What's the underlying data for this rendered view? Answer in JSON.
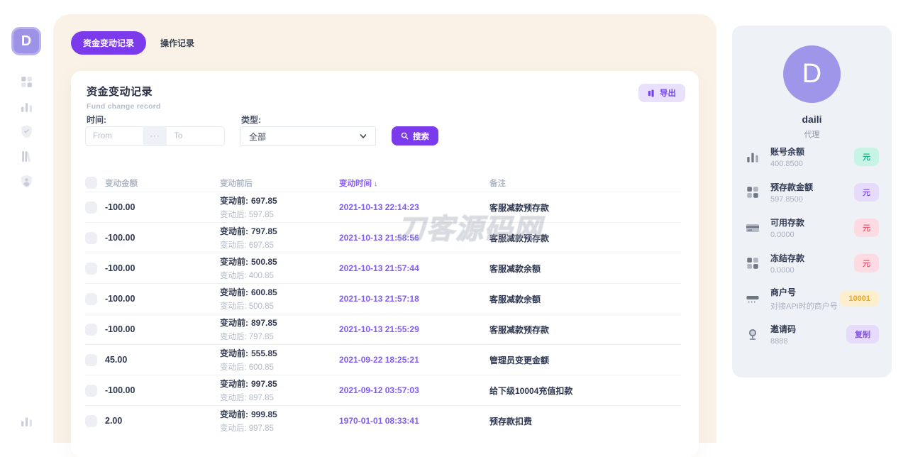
{
  "brand": {
    "logo_letter": "D"
  },
  "sidebar": {
    "icons": [
      "grid-icon",
      "bar-chart-icon",
      "shield-check-icon",
      "library-icon",
      "shield-user-icon"
    ],
    "bottom_icon": "bar-chart-icon"
  },
  "tabs": [
    {
      "label": "资金变动记录",
      "active": true
    },
    {
      "label": "操作记录",
      "active": false
    }
  ],
  "card": {
    "title": "资金变动记录",
    "subtitle": "Fund change record",
    "export_label": "导出",
    "filters": {
      "time_label": "时间:",
      "from_placeholder": "From",
      "to_placeholder": "To",
      "separator": "···",
      "type_label": "类型:",
      "type_value": "全部",
      "search_label": "搜索"
    },
    "table": {
      "headers": {
        "amount": "变动金额",
        "before_after": "变动前后",
        "time": "变动时间",
        "remark": "备注"
      },
      "sort_arrow": "↓",
      "before_prefix": "变动前:",
      "after_prefix": "变动后:",
      "rows": [
        {
          "amount": "-100.00",
          "before": "697.85",
          "after": "597.85",
          "time": "2021-10-13 22:14:23",
          "remark": "客服减款预存款"
        },
        {
          "amount": "-100.00",
          "before": "797.85",
          "after": "697.85",
          "time": "2021-10-13 21:58:56",
          "remark": "客服减款预存款"
        },
        {
          "amount": "-100.00",
          "before": "500.85",
          "after": "400.85",
          "time": "2021-10-13 21:57:44",
          "remark": "客服减款余额"
        },
        {
          "amount": "-100.00",
          "before": "600.85",
          "after": "500.85",
          "time": "2021-10-13 21:57:18",
          "remark": "客服减款余额"
        },
        {
          "amount": "-100.00",
          "before": "897.85",
          "after": "797.85",
          "time": "2021-10-13 21:55:29",
          "remark": "客服减款预存款"
        },
        {
          "amount": "45.00",
          "before": "555.85",
          "after": "600.85",
          "time": "2021-09-22 18:25:21",
          "remark": "管理员变更金额"
        },
        {
          "amount": "-100.00",
          "before": "997.85",
          "after": "897.85",
          "time": "2021-09-12 03:57:03",
          "remark": "给下级10004充值扣款"
        },
        {
          "amount": "2.00",
          "before": "999.85",
          "after": "997.85",
          "time": "1970-01-01 08:33:41",
          "remark": "预存款扣费"
        }
      ]
    }
  },
  "watermark": "刀客源码网",
  "profile": {
    "avatar_letter": "D",
    "name": "daili",
    "role": "代理",
    "stats": [
      {
        "icon": "bar-chart-icon",
        "label": "账号余额",
        "value": "400.8500",
        "badge": "元",
        "badge_style": "teal",
        "badge_click": false
      },
      {
        "icon": "grid-icon",
        "label": "预存款金额",
        "value": "597.8500",
        "badge": "元",
        "badge_style": "purple",
        "badge_click": false
      },
      {
        "icon": "credit-card-icon",
        "label": "可用存款",
        "value": "0.0000",
        "badge": "元",
        "badge_style": "pink",
        "badge_click": false
      },
      {
        "icon": "grid-icon",
        "label": "冻结存款",
        "value": "0.0000",
        "badge": "元",
        "badge_style": "pink",
        "badge_click": false
      },
      {
        "icon": "server-icon",
        "label": "商户号",
        "value": "对接API时的商户号",
        "badge": "10001",
        "badge_style": "amber",
        "badge_click": false
      },
      {
        "icon": "mic-icon",
        "label": "邀请码",
        "value": "8888",
        "badge": "复制",
        "badge_style": "purple",
        "badge_click": true
      }
    ]
  },
  "colors": {
    "accent_purple": "#7c3aed",
    "time_link_purple": "#7f5af5",
    "cream_background": "#faf2e6",
    "panel_gray": "#eef1f6",
    "avatar_purple": "#9e96e8"
  }
}
